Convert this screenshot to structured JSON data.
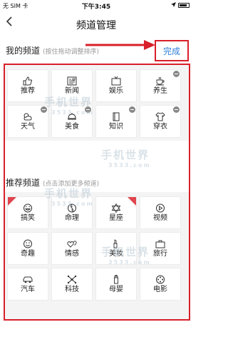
{
  "status_bar": {
    "carrier": "无 SIM 卡",
    "time": "下午3:45"
  },
  "nav": {
    "back_icon": "chevron-left-icon",
    "title": "频道管理"
  },
  "my_channels": {
    "title": "我的频道",
    "hint": "(按住拖动调整排序)",
    "done_label": "完成",
    "items": [
      {
        "label": "推荐",
        "icon": "thumbs-up-icon",
        "removable": false
      },
      {
        "label": "新闻",
        "icon": "newspaper-icon",
        "removable": false
      },
      {
        "label": "娱乐",
        "icon": "tv-icon",
        "removable": false
      },
      {
        "label": "养生",
        "icon": "teacup-icon",
        "removable": true
      },
      {
        "label": "天气",
        "icon": "weather-icon",
        "removable": true
      },
      {
        "label": "美食",
        "icon": "cloche-icon",
        "removable": true
      },
      {
        "label": "知识",
        "icon": "book-icon",
        "removable": true
      },
      {
        "label": "穿衣",
        "icon": "tshirt-icon",
        "removable": true
      }
    ]
  },
  "recommended_channels": {
    "title": "推荐频道",
    "hint": "(点击添加更多频道)",
    "items": [
      {
        "label": "搞笑",
        "icon": "laugh-icon",
        "ribbon": "left"
      },
      {
        "label": "命理",
        "icon": "yinyang-icon",
        "ribbon": "none"
      },
      {
        "label": "星座",
        "icon": "star-of-david-icon",
        "ribbon": "right"
      },
      {
        "label": "视频",
        "icon": "play-circle-icon",
        "ribbon": "none"
      },
      {
        "label": "奇趣",
        "icon": "smile-icon",
        "ribbon": "none"
      },
      {
        "label": "情感",
        "icon": "hearts-icon",
        "ribbon": "none"
      },
      {
        "label": "美妆",
        "icon": "lipstick-icon",
        "ribbon": "none"
      },
      {
        "label": "旅行",
        "icon": "suitcase-icon",
        "ribbon": "none"
      },
      {
        "label": "汽车",
        "icon": "car-icon",
        "ribbon": "none"
      },
      {
        "label": "科技",
        "icon": "network-icon",
        "ribbon": "none"
      },
      {
        "label": "母婴",
        "icon": "baby-bottle-icon",
        "ribbon": "none"
      },
      {
        "label": "电影",
        "icon": "film-reel-icon",
        "ribbon": "none"
      }
    ]
  },
  "watermark": {
    "text": "手机世界",
    "subtext": "3533.com"
  },
  "colors": {
    "highlight_red": "#d8202a",
    "link_blue": "#2f7fd8",
    "ribbon_red": "#e0454d"
  }
}
